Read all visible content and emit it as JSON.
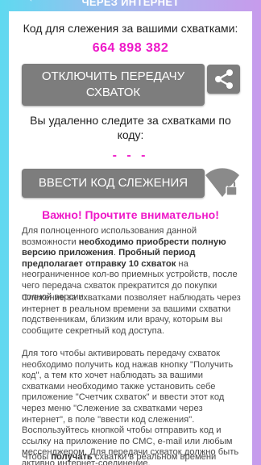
{
  "header": {
    "title": "ЧЕРЕЗ ИНТЕРНЕТ"
  },
  "tracking": {
    "label": "Код для слежения за вашими схватками:",
    "code": "664 898 382",
    "stop_button": "ОТКЛЮЧИТЬ ПЕРЕДАЧУ СХВАТОК"
  },
  "remote": {
    "label": "Вы удаленно следите за схватками по коду:",
    "code": "- - -",
    "enter_button": "ВВЕСТИ КОД СЛЕЖЕНИЯ"
  },
  "warning": "Важно! Прочтите внимательно!",
  "paragraphs": {
    "p1_a": "Для полноценного использования данной возможности ",
    "p1_b": "необходимо приобрести полную версию приложения",
    "p1_c": ". ",
    "p1_d": "Пробный период предполагает отправку 10 схваток",
    "p1_e": " на неограниченное кол-во приемных устройств, после чего передача схваток прекратится до покупки полной версии.",
    "p2": "Слежение за схватками позволяет наблюдать через интернет в реальном времени за вашими схватки подственникам, близким или врачу, которым вы сообщите секретный код доступа.",
    "p3": "Для того чтобы активировать передачу схваток необходимо получить код нажав кнопку \"Получить код\", а тем кто хочет наблюдать за вашими схватками необходимо также установить себе приложение \"Счетчик схваток\" и ввести этот код через меню \"Слежение за схватками через интернет\", в поле \"ввести код слежения\". Воспользуйтесь кнопкой чтобы отправить код и ссылку на приложение по СМС, e-mail или любым мессенджером. Для передачи схваток должно быть активно интернет-соединение.",
    "p4_a": "Чтобы ",
    "p4_b": "получать",
    "p4_c": " схватки в реальном времени"
  },
  "colors": {
    "accent": "#ee18c8",
    "button": "#7d7d7d"
  }
}
